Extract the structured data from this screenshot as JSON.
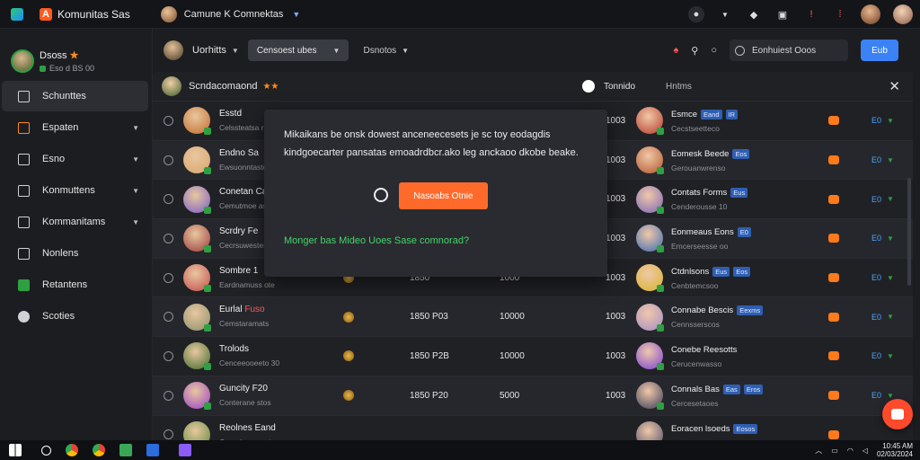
{
  "topbar": {
    "app_title": "Komunitas Sas",
    "app_logo_letter": "A",
    "workspace_name": "Camune K Comnektas",
    "icons": [
      "logo-icon",
      "search-icon",
      "notification-icon",
      "chat-icon",
      "alert-icon",
      "alert-icon-2"
    ]
  },
  "sidebar": {
    "profile_name": "Dsoss",
    "profile_badge": "★",
    "profile_sub": "Eso d BS 00",
    "items": [
      {
        "label": "Schunttes",
        "icon": "grid-icon"
      },
      {
        "label": "Espaten",
        "icon": "user-icon"
      },
      {
        "label": "Esno",
        "icon": "folder-icon"
      },
      {
        "label": "Konmuttens",
        "icon": "people-icon"
      },
      {
        "label": "Kommanitams",
        "icon": "share-icon"
      },
      {
        "label": "Nonlens",
        "icon": "list-icon"
      },
      {
        "label": "Retantens",
        "icon": "calendar-icon"
      },
      {
        "label": "Scoties",
        "icon": "settings-icon"
      }
    ]
  },
  "toolbar": {
    "user_label": "Uorhitts",
    "dropdown_label": "Censoest ubes",
    "link_label": "Dsnotos",
    "search_placeholder": "Eonhuiest Ooos",
    "button_label": "Eub"
  },
  "panel": {
    "header_title": "Scndacomaond",
    "header_stars": "★★",
    "header_mid": "Tonnido",
    "header_mid2": "Hntms"
  },
  "rows": [
    {
      "name": "Esstd",
      "name_flag": "",
      "sub": "Celssteatsa rotos",
      "c1": "",
      "c2": "",
      "c3": "1003",
      "name2": "Esmce",
      "tags2": [
        "Eand",
        "IR"
      ],
      "sub2": "Cecstseetteco",
      "ver": "E0"
    },
    {
      "name": "Endno Sa",
      "name_flag": "",
      "sub": "Ewsuonntastos",
      "c1": "",
      "c2": "",
      "c3": "1003",
      "name2": "Eomesk Beede",
      "tags2": [
        "Eos"
      ],
      "sub2": "Gerouanwrenso",
      "ver": "E0"
    },
    {
      "name": "Conetan Ca",
      "name_flag": "",
      "sub": "Cemutmoe aszes",
      "c1": "",
      "c2": "",
      "c3": "1003",
      "name2": "Contats Forms",
      "tags2": [
        "Eus"
      ],
      "sub2": "Cenderousse 10",
      "ver": "E0"
    },
    {
      "name": "Scrdry Fe",
      "name_flag": "",
      "sub": "Cecrsuwestes",
      "c1": "",
      "c2": "",
      "c3": "1003",
      "name2": "Eonmeaus Eons",
      "tags2": [
        "E0"
      ],
      "sub2": "Emcerseesse oo",
      "ver": "E0"
    },
    {
      "name": "Sombre 1",
      "name_flag": "",
      "sub": "Eardnamuss ote",
      "c1": "1850",
      "c2": "1000",
      "c3": "1003",
      "name2": "Ctdnlsons",
      "tags2": [
        "Eus",
        "Eos"
      ],
      "sub2": "Cenbtemcsoo",
      "ver": "E0"
    },
    {
      "name": "Eurlal",
      "name_flag": "Fuso",
      "sub": "Cemstaramats",
      "c1": "1850 P03",
      "c2": "10000",
      "c3": "1003",
      "name2": "Connabe Bescis",
      "tags2": [
        "Eexms"
      ],
      "sub2": "Cennsserscos",
      "ver": "E0"
    },
    {
      "name": "Trolods",
      "name_flag": "",
      "sub": "Cenceeooeeto 30",
      "c1": "1850 P2B",
      "c2": "10000",
      "c3": "1003",
      "name2": "Conebe Reesotts",
      "tags2": [],
      "sub2": "Cerucenwasso",
      "ver": "E0"
    },
    {
      "name": "Guncity F20",
      "name_flag": "",
      "sub": "Conterane stos",
      "c1": "1850 P20",
      "c2": "5000",
      "c3": "1003",
      "name2": "Connals Bas",
      "tags2": [
        "Eas",
        "Eros"
      ],
      "sub2": "Cercesetaoes",
      "ver": "E0"
    },
    {
      "name": "Reolnes Eand",
      "name_flag": "",
      "sub": "Ceandsenrusates",
      "c1": "",
      "c2": "",
      "c3": "",
      "name2": "Eoracen lsoeds",
      "tags2": [
        "Eosos"
      ],
      "sub2": "",
      "ver": ""
    }
  ],
  "modal": {
    "message_line1": "Mikaikans be onsk dowest  anceneecesets je sc toy eodagdis",
    "message_line2": "kindgoecarter pansatas emoadrdbcr.ako leg  anckaoo dkobe beake.",
    "cta_label": "Nasoabs Otnie",
    "hint": "Monger bas Mideo Uoes Sase comnorad?"
  },
  "taskbar": {
    "clock_line1": "10:45 AM",
    "clock_line2": "02/03/2024"
  },
  "colors": {
    "accent": "#3b82f6",
    "cta": "#ff6a2b",
    "online": "#2ea043",
    "hint": "#46d36a"
  }
}
